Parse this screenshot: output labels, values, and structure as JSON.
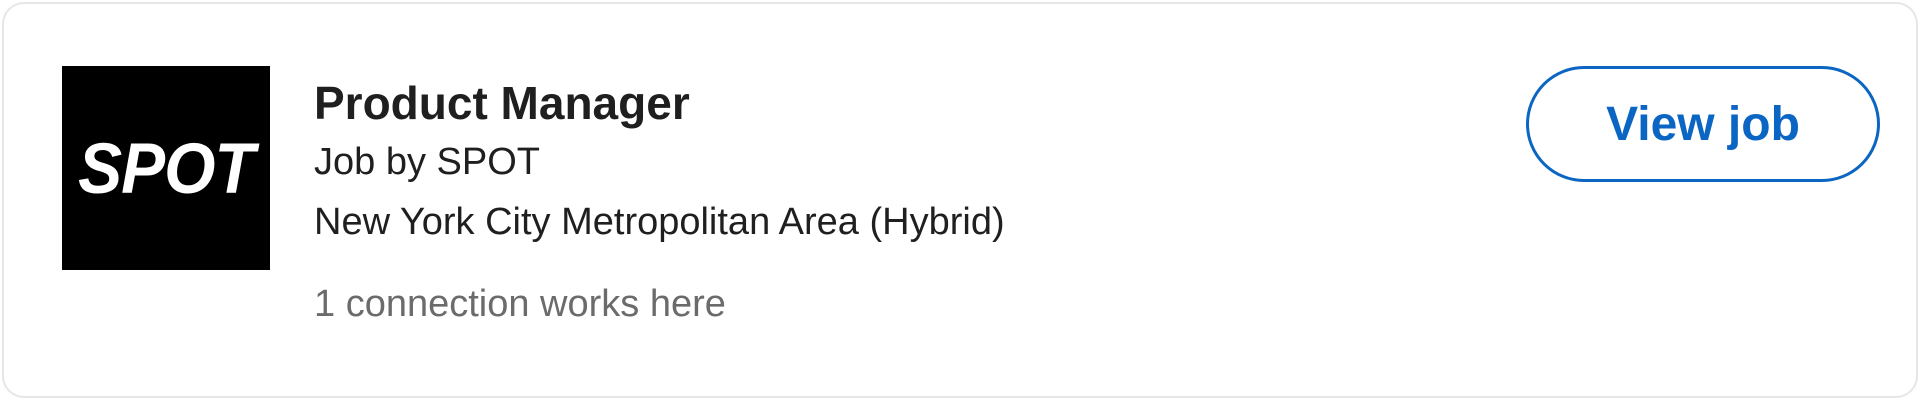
{
  "job": {
    "company_logo_text": "SPOT",
    "title": "Product Manager",
    "company_line": "Job by SPOT",
    "location": "New York City Metropolitan Area (Hybrid)",
    "insight": "1 connection works here"
  },
  "actions": {
    "view_job_label": "View job"
  },
  "colors": {
    "accent": "#0a66c2",
    "logo_bg": "#000000",
    "text_primary": "#1f1f1f",
    "text_secondary": "#6b6b6b",
    "border": "#e6e6e6"
  }
}
